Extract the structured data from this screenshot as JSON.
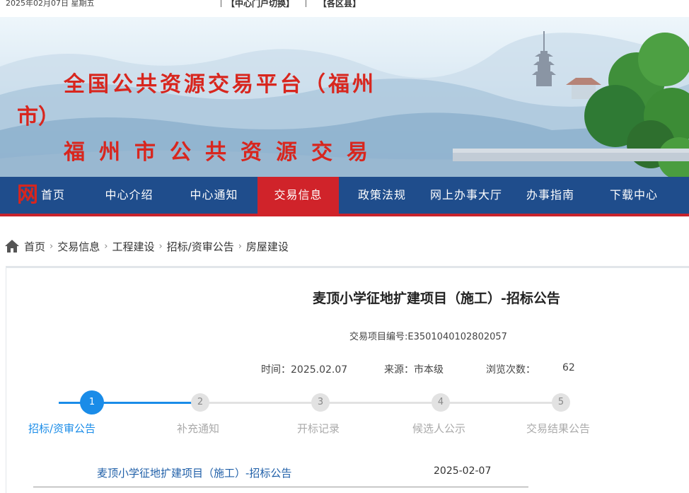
{
  "topbar": {
    "date": "2025年02月07日   星期五",
    "link_center": "【中心门户切换】",
    "link_counties": "【各区县】"
  },
  "banner": {
    "title_line1": "全国公共资源交易平台（福州",
    "title_line1_wrap": "市）",
    "title_line2": "福州市公共资源交易",
    "title_line2_wrap": "网"
  },
  "nav": {
    "items": [
      {
        "label": "首页"
      },
      {
        "label": "中心介绍"
      },
      {
        "label": "中心通知"
      },
      {
        "label": "交易信息"
      },
      {
        "label": "政策法规"
      },
      {
        "label": "网上办事大厅"
      },
      {
        "label": "办事指南"
      },
      {
        "label": "下载中心"
      }
    ],
    "active_index": 3
  },
  "breadcrumb": [
    "首页",
    "交易信息",
    "工程建设",
    "招标/资审公告",
    "房屋建设"
  ],
  "article": {
    "title": "麦顶小学征地扩建项目（施工）-招标公告",
    "project_code": "交易项目编号:E3501040102802057",
    "time_label": "时间：2025.02.07",
    "source_label": "来源：市本级",
    "views_label": "浏览次数：",
    "views_value": "62"
  },
  "steps": [
    {
      "num": "1",
      "label": "招标/资审公告"
    },
    {
      "num": "2",
      "label": "补充通知"
    },
    {
      "num": "3",
      "label": "开标记录"
    },
    {
      "num": "4",
      "label": "候选人公示"
    },
    {
      "num": "5",
      "label": "交易结果公告"
    }
  ],
  "list": {
    "title": "麦顶小学征地扩建项目（施工）-招标公告",
    "date": "2025-02-07"
  },
  "colors": {
    "nav_bg": "#1f4d8c",
    "nav_active": "#d0232a",
    "accent_blue": "#1a8ce8",
    "title_red": "#d8261e"
  }
}
